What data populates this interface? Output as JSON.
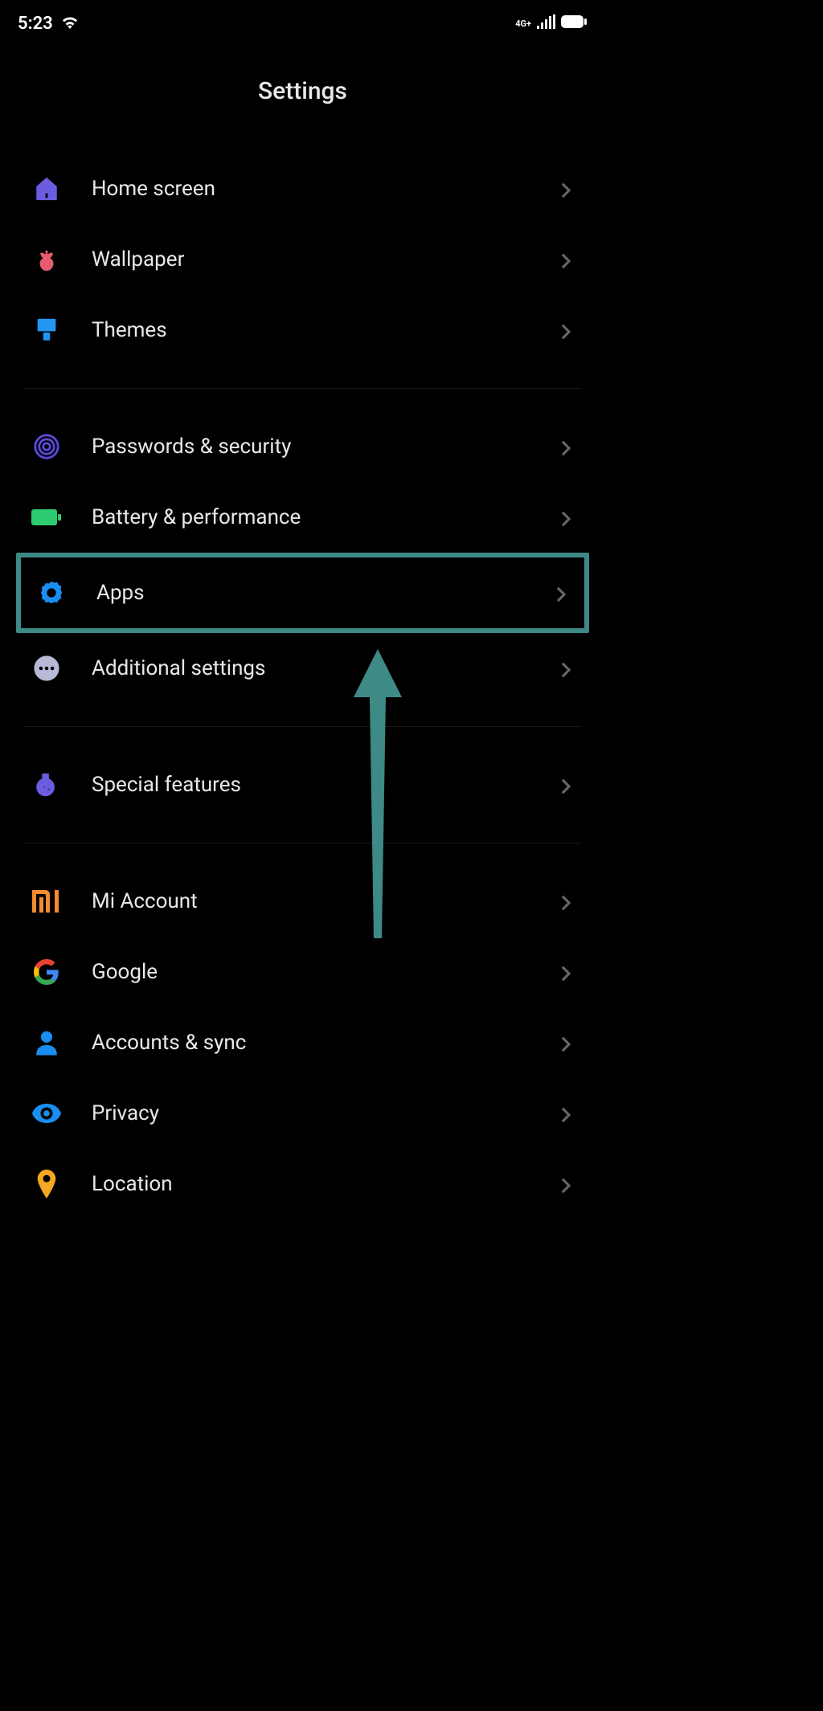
{
  "status": {
    "time": "5:23",
    "network_label": "4G+"
  },
  "title": "Settings",
  "groups": [
    {
      "items": [
        {
          "key": "home-screen",
          "label": "Home screen",
          "icon": "home-icon"
        },
        {
          "key": "wallpaper",
          "label": "Wallpaper",
          "icon": "wallpaper-icon"
        },
        {
          "key": "themes",
          "label": "Themes",
          "icon": "themes-icon"
        }
      ]
    },
    {
      "items": [
        {
          "key": "passwords-security",
          "label": "Passwords & security",
          "icon": "fingerprint-icon"
        },
        {
          "key": "battery-performance",
          "label": "Battery & performance",
          "icon": "battery-icon"
        },
        {
          "key": "apps",
          "label": "Apps",
          "icon": "gear-icon",
          "highlighted": true
        },
        {
          "key": "additional-settings",
          "label": "Additional settings",
          "icon": "more-icon"
        }
      ]
    },
    {
      "items": [
        {
          "key": "special-features",
          "label": "Special features",
          "icon": "flask-icon"
        }
      ]
    },
    {
      "items": [
        {
          "key": "mi-account",
          "label": "Mi Account",
          "icon": "mi-logo-icon"
        },
        {
          "key": "google",
          "label": "Google",
          "icon": "google-icon"
        },
        {
          "key": "accounts-sync",
          "label": "Accounts & sync",
          "icon": "user-icon"
        },
        {
          "key": "privacy",
          "label": "Privacy",
          "icon": "eye-icon"
        },
        {
          "key": "location",
          "label": "Location",
          "icon": "pin-icon"
        }
      ]
    }
  ],
  "annotation": {
    "type": "arrow-up",
    "color": "#3d8a87",
    "target": "apps"
  }
}
